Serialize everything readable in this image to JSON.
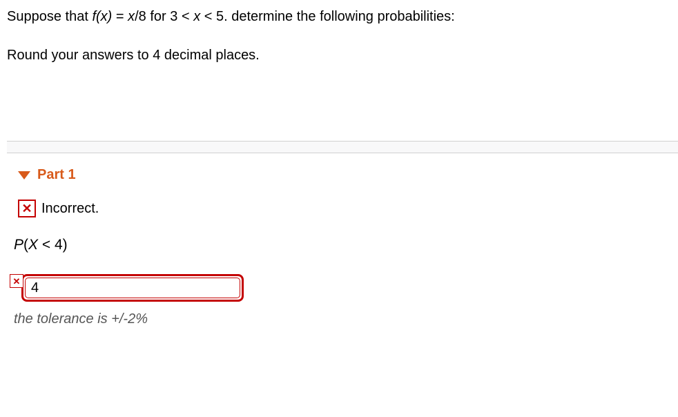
{
  "problem": {
    "line1_a": "Suppose that ",
    "line1_fx": "f(x)",
    "line1_b": " = ",
    "line1_x": "x",
    "line1_c": "/8 for 3 < ",
    "line1_x2": "x",
    "line1_d": " < 5. determine the following probabilities:",
    "line2": "Round your answers to 4 decimal places."
  },
  "part": {
    "title": "Part 1",
    "feedback_icon": "✕",
    "feedback_text": "Incorrect.",
    "question_px": "P",
    "question_open": "(",
    "question_var": "X",
    "question_rest": " < 4)",
    "answer_icon": "✕",
    "answer_value": "4",
    "tolerance": "the tolerance is +/-2%"
  }
}
